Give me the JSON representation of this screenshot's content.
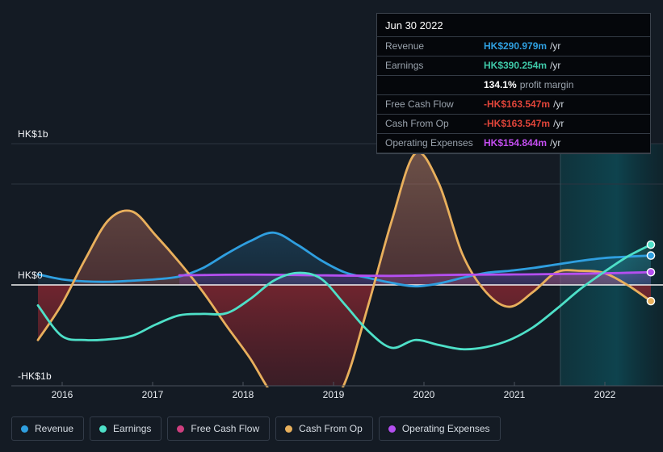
{
  "chart_data": {
    "type": "area",
    "title": "",
    "xlabel": "",
    "ylabel": "HK$",
    "currency": "HK$",
    "grid": true,
    "legend_position": "bottom",
    "x_ticks": [
      "2016",
      "2017",
      "2018",
      "2019",
      "2020",
      "2021",
      "2022"
    ],
    "y_ticks": [
      "HK$1b",
      "HK$0",
      "-HK$1b"
    ],
    "ylim": [
      -1.0,
      1.0
    ],
    "forecast_start": "2021.75",
    "series": [
      {
        "name": "Revenue",
        "color": "#2f9fe0",
        "values": [
          0.075,
          0.04,
          0.025,
          0.022,
          0.03,
          0.04,
          0.06,
          0.12,
          0.22,
          0.31,
          0.37,
          0.285,
          0.175,
          0.09,
          0.05,
          0.015,
          -0.01,
          0.01,
          0.05,
          0.085,
          0.1,
          0.12,
          0.145,
          0.17,
          0.19,
          0.2,
          0.208
        ]
      },
      {
        "name": "Earnings",
        "color": "#4ee0c8",
        "values": [
          -0.145,
          -0.36,
          -0.39,
          -0.385,
          -0.36,
          -0.28,
          -0.215,
          -0.205,
          -0.2,
          -0.1,
          0.03,
          0.085,
          0.045,
          -0.135,
          -0.325,
          -0.445,
          -0.39,
          -0.425,
          -0.455,
          -0.44,
          -0.39,
          -0.3,
          -0.17,
          -0.03,
          0.09,
          0.2,
          0.285
        ]
      },
      {
        "name": "Free Cash Flow",
        "color": "#cf3f7f",
        "values": [
          -0.39,
          -0.14,
          0.18,
          0.46,
          0.52,
          0.35,
          0.16,
          -0.05,
          -0.29,
          -0.52,
          -0.79,
          -0.93,
          -0.93,
          -0.7,
          -0.15,
          0.45,
          0.93,
          0.72,
          0.22,
          -0.05,
          -0.155,
          -0.05,
          0.09,
          0.1,
          0.085,
          0.0,
          -0.115
        ]
      },
      {
        "name": "Cash From Op",
        "color": "#e8b05c",
        "values": [
          -0.39,
          -0.14,
          0.18,
          0.46,
          0.52,
          0.35,
          0.16,
          -0.05,
          -0.29,
          -0.52,
          -0.79,
          -0.93,
          -0.93,
          -0.7,
          -0.15,
          0.45,
          0.93,
          0.72,
          0.22,
          -0.05,
          -0.155,
          -0.05,
          0.09,
          0.1,
          0.085,
          0.0,
          -0.115
        ]
      },
      {
        "name": "Operating Expenses",
        "color": "#b44ff0",
        "values": [
          null,
          null,
          null,
          null,
          null,
          null,
          0.068,
          0.07,
          0.072,
          0.073,
          0.072,
          0.07,
          0.068,
          0.066,
          0.065,
          0.064,
          0.066,
          0.07,
          0.072,
          0.073,
          0.074,
          0.075,
          0.077,
          0.079,
          0.082,
          0.086,
          0.09
        ]
      }
    ]
  },
  "axis": {
    "y_top_label": "HK$1b",
    "y_zero_label": "HK$0",
    "y_bottom_label": "-HK$1b",
    "x_labels": [
      "2016",
      "2017",
      "2018",
      "2019",
      "2020",
      "2021",
      "2022"
    ]
  },
  "tooltip": {
    "date": "Jun 30 2022",
    "rows": [
      {
        "label": "Revenue",
        "value": "HK$290.979m",
        "unit": "/yr",
        "color": "#2f9fe0",
        "sub": ""
      },
      {
        "label": "Earnings",
        "value": "HK$390.254m",
        "unit": "/yr",
        "color": "#3fc9a8",
        "sub": ""
      },
      {
        "label": "",
        "value": "134.1%",
        "unit": "",
        "color": "#ffffff",
        "sub": "profit margin"
      },
      {
        "label": "Free Cash Flow",
        "value": "-HK$163.547m",
        "unit": "/yr",
        "color": "#e0453a",
        "sub": ""
      },
      {
        "label": "Cash From Op",
        "value": "-HK$163.547m",
        "unit": "/yr",
        "color": "#e0453a",
        "sub": ""
      },
      {
        "label": "Operating Expenses",
        "value": "HK$154.844m",
        "unit": "/yr",
        "color": "#c44ef0",
        "sub": ""
      }
    ]
  },
  "legend": {
    "items": [
      {
        "label": "Revenue",
        "color": "#2f9fe0"
      },
      {
        "label": "Earnings",
        "color": "#4ee0c8"
      },
      {
        "label": "Free Cash Flow",
        "color": "#cf3f7f"
      },
      {
        "label": "Cash From Op",
        "color": "#e8b05c"
      },
      {
        "label": "Operating Expenses",
        "color": "#b44ff0"
      }
    ]
  }
}
